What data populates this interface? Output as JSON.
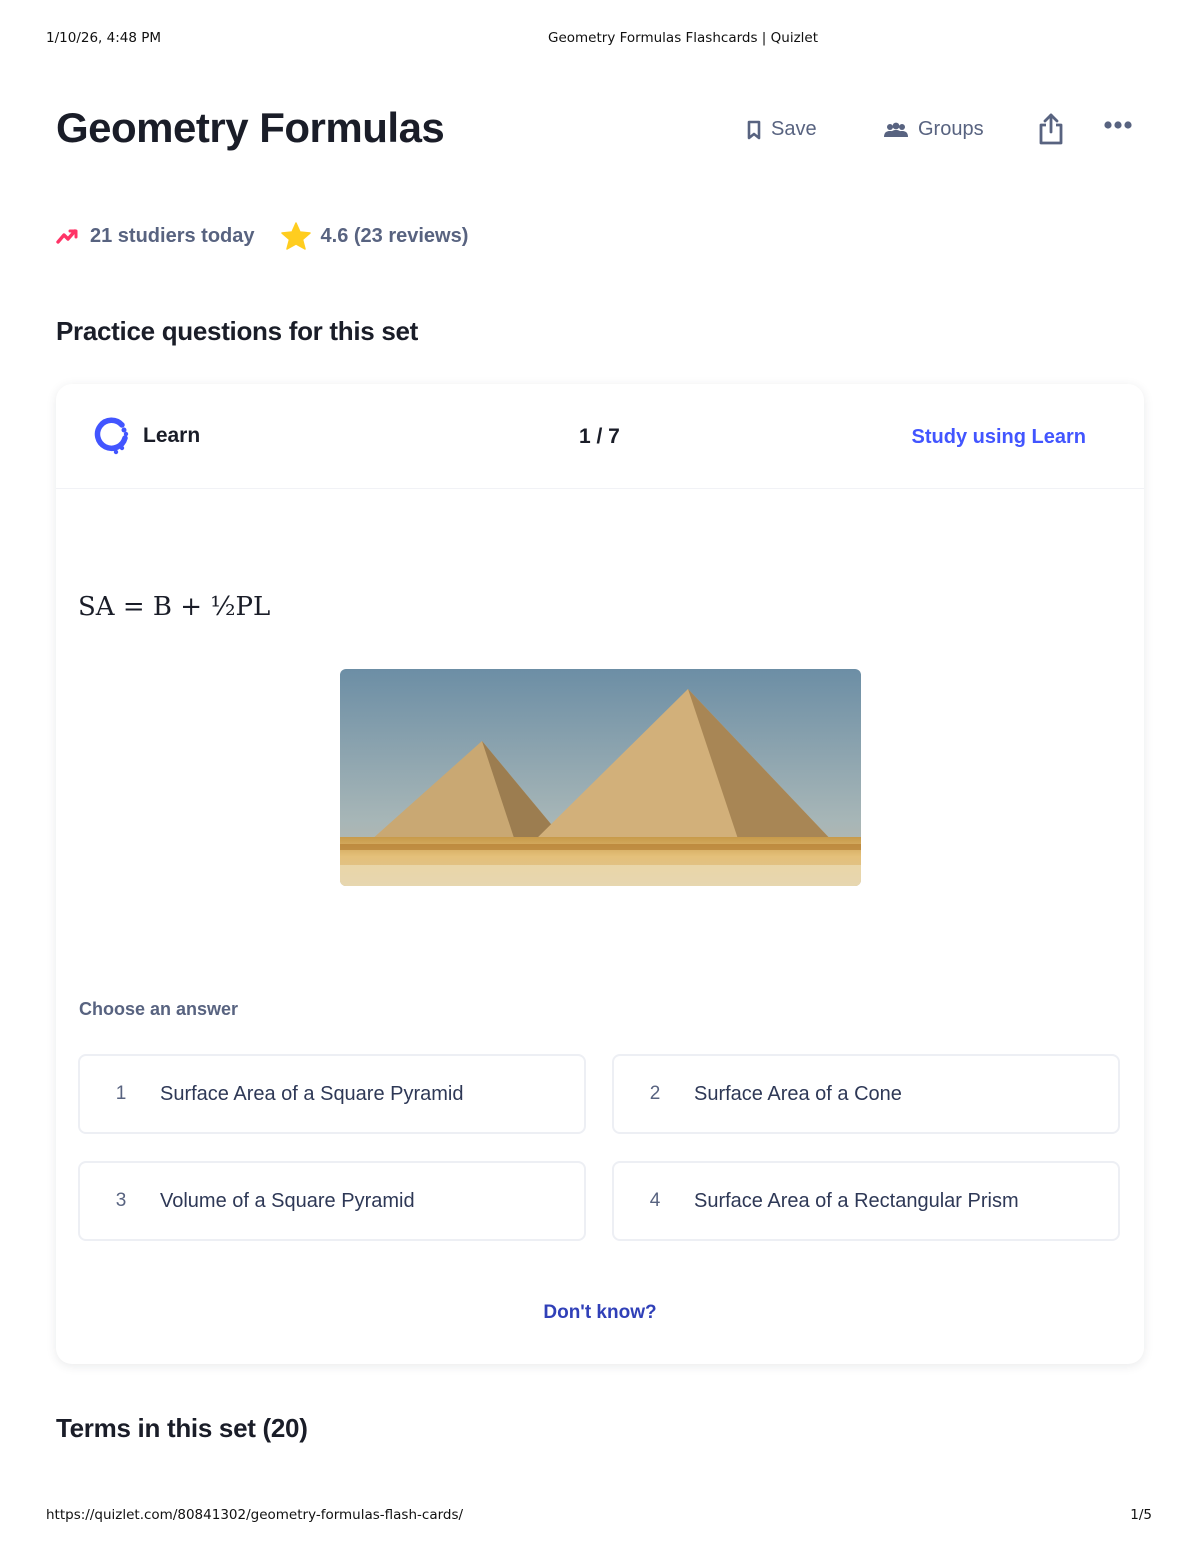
{
  "print_header": {
    "datetime": "1/10/26, 4:48 PM",
    "page_title": "Geometry Formulas Flashcards | Quizlet"
  },
  "set": {
    "title": "Geometry Formulas"
  },
  "actions": {
    "save": "Save",
    "groups": "Groups",
    "save_icon": "bookmark-icon",
    "groups_icon": "groups-icon",
    "share_icon": "share-icon",
    "more_icon": "more-dots-icon"
  },
  "stats": {
    "studiers": "21 studiers today",
    "rating": "4.6 (23 reviews)",
    "trend_icon": "trending-up-icon",
    "star_icon": "star-icon",
    "trend_color": "#ff3366",
    "star_color": "#ffcd1f"
  },
  "practice": {
    "heading": "Practice questions for this set",
    "mode_label": "Learn",
    "progress": "1 / 7",
    "study_link": "Study using Learn",
    "term": "SA = B + ½PL",
    "image_alt_icon": "pyramids-photo",
    "choose_label": "Choose an answer",
    "options": [
      {
        "num": "1",
        "label": "Surface Area of a Square Pyramid"
      },
      {
        "num": "2",
        "label": "Surface Area of a Cone"
      },
      {
        "num": "3",
        "label": "Volume of a Square Pyramid"
      },
      {
        "num": "4",
        "label": "Surface Area of a Rectangular Prism"
      }
    ],
    "dont_know": "Don't know?"
  },
  "terms": {
    "heading": "Terms in this set (20)"
  },
  "print_footer": {
    "url": "https://quizlet.com/80841302/geometry-formulas-flash-cards/",
    "page": "1/5"
  },
  "colors": {
    "accent": "#4255ff",
    "text": "#1a1d28",
    "muted": "#586380"
  }
}
